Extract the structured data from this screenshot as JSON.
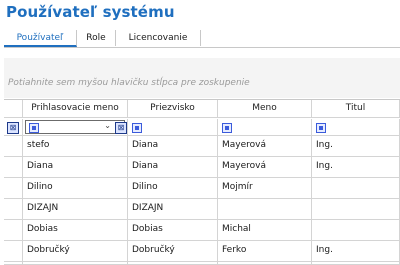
{
  "title": "Používateľ systému",
  "tabs": [
    {
      "label": "Používateľ",
      "active": true
    },
    {
      "label": "Role",
      "active": false
    },
    {
      "label": "Licencovanie",
      "active": false
    }
  ],
  "group_hint": "Potiahnite sem myšou hlavičku stĺpca pre zoskupenie",
  "columns": [
    "Prihlasovacie meno",
    "Priezvisko",
    "Meno",
    "Titul"
  ],
  "rows": [
    [
      "stefo",
      "Diana",
      "Mayerová",
      "Ing."
    ],
    [
      "Diana",
      "Diana",
      "Mayerová",
      "Ing."
    ],
    [
      "Dilino",
      "Dilino",
      "Mojmír",
      ""
    ],
    [
      "DIZAJN",
      "DIZAJN",
      "",
      ""
    ],
    [
      "Dobias",
      "Dobias",
      "Michal",
      ""
    ],
    [
      "Dobručký",
      "Dobručký",
      "Ferko",
      "Ing."
    ],
    [
      "",
      "",
      "",
      ""
    ]
  ],
  "icons": {
    "filter_row_icon": "filter-clear-icon",
    "filter_cell_icon": "filter-operator-icon",
    "dropdown_icon": "chevron-down-icon"
  },
  "colors": {
    "accent": "#1f6fbf"
  }
}
